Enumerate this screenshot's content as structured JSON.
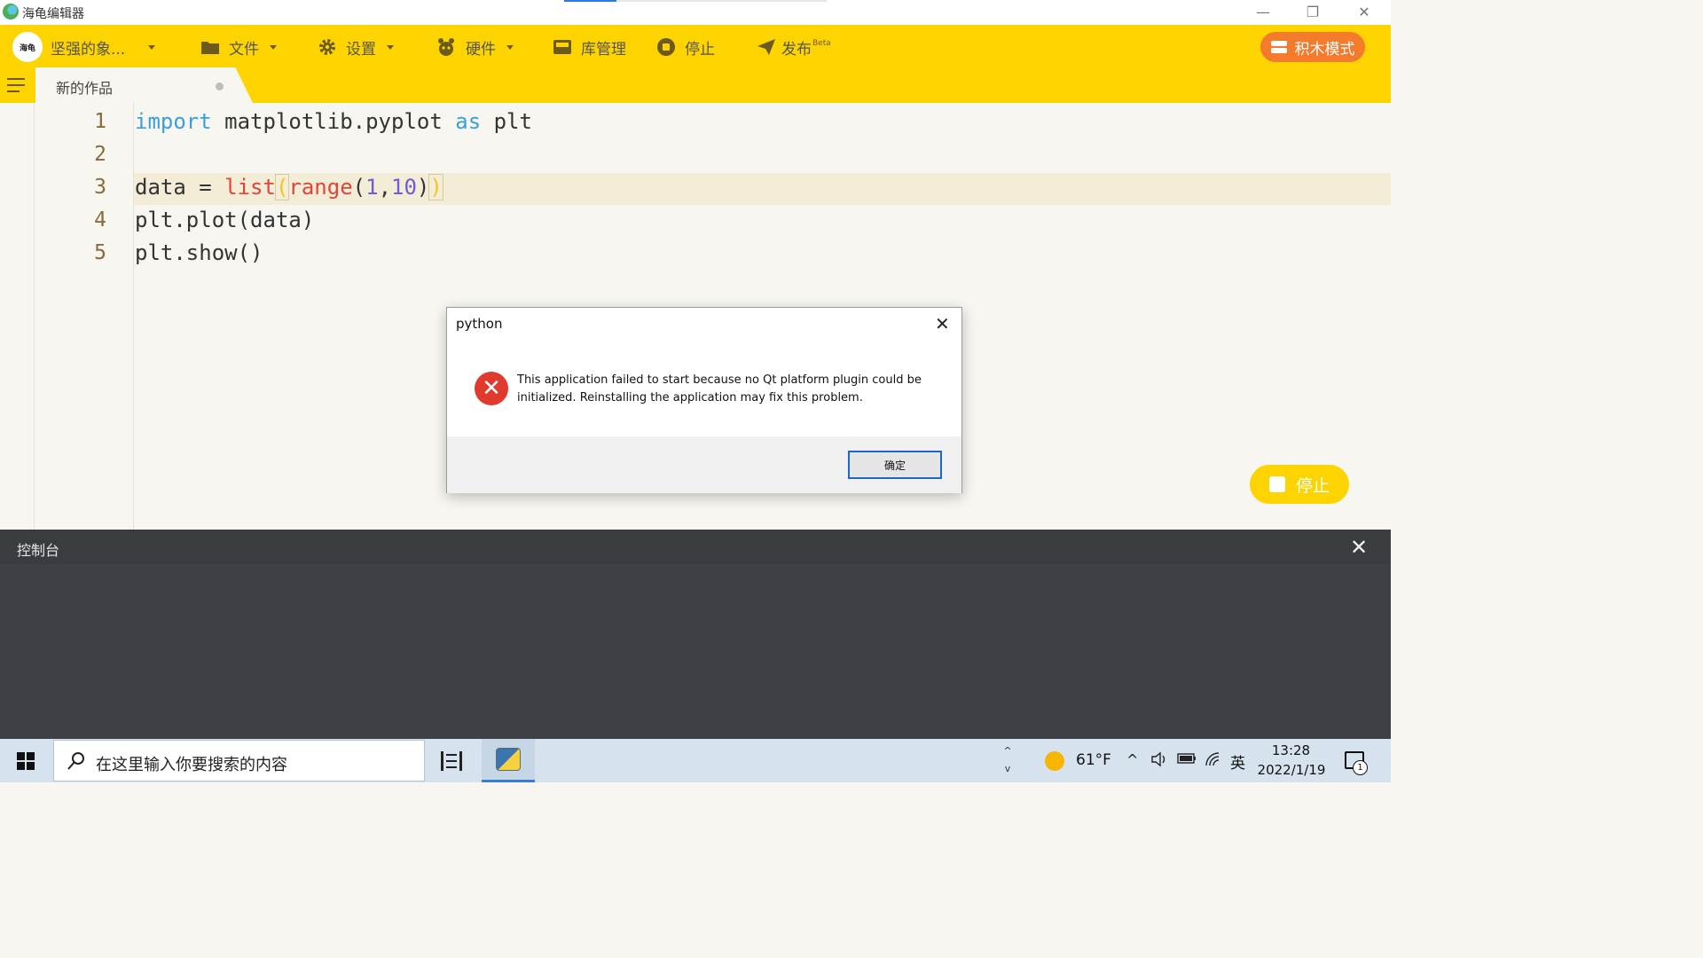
{
  "window": {
    "title": "海龟编辑器",
    "controls": {
      "minimize": "—",
      "restore": "❐",
      "close": "✕"
    }
  },
  "toolbar": {
    "avatar_text": "海龟",
    "user_name": "坚强的象...",
    "file": "文件",
    "settings": "设置",
    "hardware": "硬件",
    "library": "库管理",
    "stop": "停止",
    "publish": "发布",
    "publish_badge": "Beta",
    "block_mode": "积木模式",
    "accent_color": "#fed400"
  },
  "tabs": {
    "active": "新的作品"
  },
  "editor": {
    "line_numbers": [
      "1",
      "2",
      "3",
      "4",
      "5"
    ],
    "lines": {
      "l1_kw1": "import",
      "l1_mid": " matplotlib.pyplot ",
      "l1_kw2": "as",
      "l1_end": " plt",
      "l3_start": "data = ",
      "l3_fn1": "list",
      "l3_open": "(",
      "l3_fn2": "range",
      "l3_paren": "(",
      "l3_n1": "1",
      "l3_comma": ",",
      "l3_n2": "10",
      "l3_close1": ")",
      "l3_close2": ")",
      "l4": "plt.plot(data)",
      "l5": "plt.show()"
    }
  },
  "float_stop": {
    "label": "停止"
  },
  "console": {
    "title": "控制台",
    "close": "✕"
  },
  "dialog": {
    "title": "python",
    "close": "✕",
    "message": "This application failed to start because no Qt platform plugin could be initialized. Reinstalling the application may fix this problem.",
    "ok": "确定",
    "error_glyph": "✕"
  },
  "taskbar": {
    "search_placeholder": "在这里输入你要搜索的内容",
    "temperature": "61°F",
    "lang": "英",
    "time": "13:28",
    "date": "2022/1/19",
    "notification_count": "1",
    "scroll_up": "^",
    "scroll_down": "v",
    "tray_chevron": "^"
  }
}
